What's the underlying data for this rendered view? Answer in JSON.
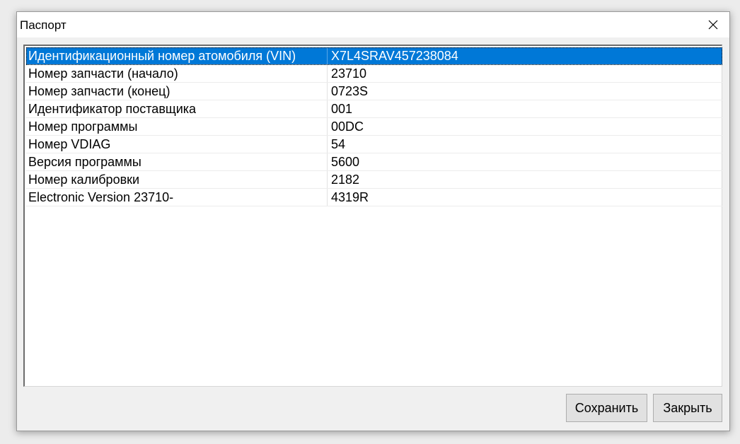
{
  "window": {
    "title": "Паспорт"
  },
  "table": {
    "selected_index": 0,
    "rows": [
      {
        "label": "Идентификационный номер атомобиля (VIN)",
        "value": "X7L4SRAV457238084"
      },
      {
        "label": "Номер запчасти (начало)",
        "value": "23710"
      },
      {
        "label": "Номер запчасти (конец)",
        "value": "0723S"
      },
      {
        "label": "Идентификатор поставщика",
        "value": "001"
      },
      {
        "label": "Номер программы",
        "value": "00DC"
      },
      {
        "label": "Номер VDIAG",
        "value": "54"
      },
      {
        "label": "Версия программы",
        "value": "5600"
      },
      {
        "label": "Номер калибровки",
        "value": "2182"
      },
      {
        "label": "Electronic Version 23710-",
        "value": "4319R"
      }
    ]
  },
  "buttons": {
    "save_label": "Сохранить",
    "close_label": "Закрыть"
  },
  "colors": {
    "selection": "#0078d7"
  },
  "icons": {
    "close": "close-icon"
  }
}
